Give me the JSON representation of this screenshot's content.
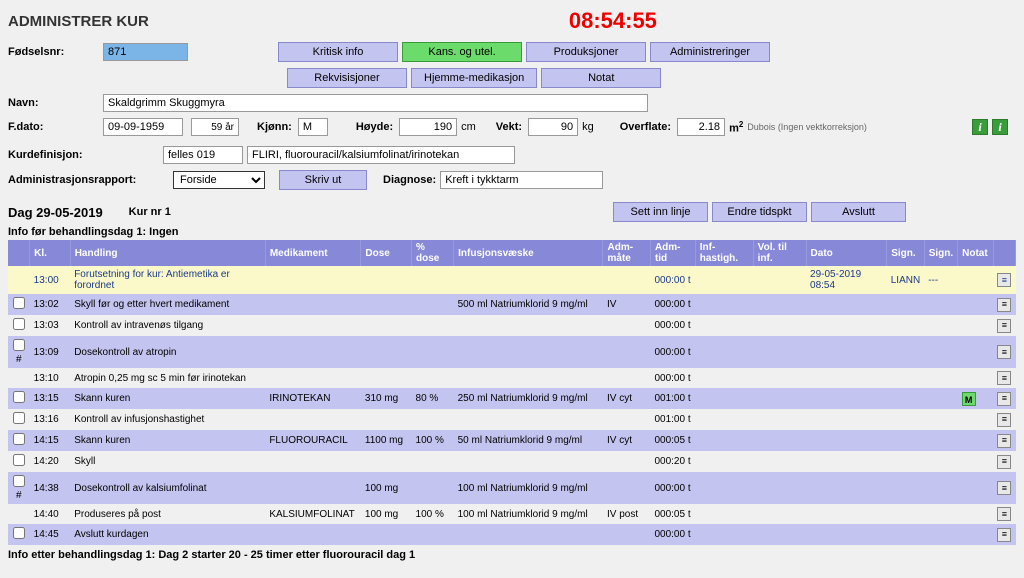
{
  "app_title": "ADMINISTRER KUR",
  "clock": "08:54:55",
  "labels": {
    "fodselsnr": "Fødselsnr:",
    "navn": "Navn:",
    "fdato": "F.dato:",
    "kjonn": "Kjønn:",
    "hoyde": "Høyde:",
    "vekt": "Vekt:",
    "overflate": "Overflate:",
    "kurdef": "Kurdefinisjon:",
    "adminrapport": "Administrasjonsrapport:",
    "diagnose": "Diagnose:",
    "cm": "cm",
    "kg": "kg",
    "m2": "m",
    "dubois": "Dubois (Ingen vektkorreksjon)",
    "info_for": "Info før behandlingsdag 1: Ingen",
    "info_etter": "Info etter behandlingsdag 1: Dag 2 starter 20 - 25 timer etter fluorouracil dag 1"
  },
  "buttons": {
    "kritisk": "Kritisk info",
    "kans": "Kans. og utel.",
    "produksjoner": "Produksjoner",
    "administreringer": "Administreringer",
    "rekvisisjoner": "Rekvisisjoner",
    "hjemme": "Hjemme-medikasjon",
    "notat": "Notat",
    "skrivut": "Skriv ut",
    "settinn": "Sett inn linje",
    "endre": "Endre tidspkt",
    "avslutt": "Avslutt"
  },
  "patient": {
    "fodselsnr": "871",
    "navn": "Skaldgrimm Skuggmyra",
    "fdato": "09-09-1959",
    "age": "59 år",
    "kjonn": "M",
    "hoyde": "190",
    "vekt": "90",
    "overflate": "2.18"
  },
  "kur": {
    "def1": "felles 019",
    "def2": "FLIRI, fluorouracil/kalsiumfolinat/irinotekan",
    "rapport": "Forside",
    "diagnose": "Kreft i tykktarm",
    "dag_title": "Dag 29-05-2019",
    "kurnr": "Kur nr 1"
  },
  "table": {
    "headers": [
      "Kl.",
      "Handling",
      "Medikament",
      "Dose",
      "% dose",
      "Infusjonsvæske",
      "Adm-måte",
      "Adm-tid",
      "Inf-hastigh.",
      "Vol. til inf.",
      "Dato",
      "Sign.",
      "Sign.",
      "Notat"
    ],
    "rows": [
      {
        "cb": false,
        "yellow": true,
        "kl": "13:00",
        "handling": "Forutsetning for kur: Antiemetika er forordnet",
        "med": "",
        "dose": "",
        "pct": "",
        "infv": "",
        "adm": "",
        "admtid": "000:00 t",
        "infh": "",
        "vol": "",
        "dato": "29-05-2019 08:54",
        "sign1": "LIANN",
        "sign2": "---",
        "notat": "",
        "mbadge": false
      },
      {
        "cb": true,
        "lav": true,
        "kl": "13:02",
        "handling": "Skyll før og etter hvert medikament",
        "med": "",
        "dose": "",
        "pct": "",
        "infv": "500 ml Natriumklorid 9 mg/ml",
        "adm": "IV",
        "admtid": "000:00 t",
        "infh": "",
        "vol": "",
        "dato": "",
        "sign1": "",
        "sign2": "",
        "notat": "",
        "mbadge": false
      },
      {
        "cb": true,
        "lav": false,
        "kl": "13:03",
        "handling": "Kontroll av intravenøs tilgang",
        "med": "",
        "dose": "",
        "pct": "",
        "infv": "",
        "adm": "",
        "admtid": "000:00 t",
        "infh": "",
        "vol": "",
        "dato": "",
        "sign1": "",
        "sign2": "",
        "notat": "",
        "mbadge": false
      },
      {
        "cb": true,
        "lav": true,
        "hash": "#",
        "kl": "13:09",
        "handling": "Dosekontroll av atropin",
        "med": "",
        "dose": "",
        "pct": "",
        "infv": "",
        "adm": "",
        "admtid": "000:00 t",
        "infh": "",
        "vol": "",
        "dato": "",
        "sign1": "",
        "sign2": "",
        "notat": "",
        "mbadge": false
      },
      {
        "cb": false,
        "lav": false,
        "kl": "13:10",
        "handling": "Atropin 0,25 mg sc 5 min før irinotekan",
        "med": "",
        "dose": "",
        "pct": "",
        "infv": "",
        "adm": "",
        "admtid": "000:00 t",
        "infh": "",
        "vol": "",
        "dato": "",
        "sign1": "",
        "sign2": "",
        "notat": "",
        "mbadge": false
      },
      {
        "cb": true,
        "lav": true,
        "kl": "13:15",
        "handling": "Skann kuren",
        "med": "IRINOTEKAN",
        "dose": "310 mg",
        "pct": "80 %",
        "infv": "250 ml Natriumklorid 9 mg/ml",
        "adm": "IV cyt",
        "admtid": "001:00 t",
        "infh": "",
        "vol": "",
        "dato": "",
        "sign1": "",
        "sign2": "",
        "notat": "",
        "mbadge": true
      },
      {
        "cb": true,
        "lav": false,
        "kl": "13:16",
        "handling": "Kontroll av infusjonshastighet",
        "med": "",
        "dose": "",
        "pct": "",
        "infv": "",
        "adm": "",
        "admtid": "001:00 t",
        "infh": "",
        "vol": "",
        "dato": "",
        "sign1": "",
        "sign2": "",
        "notat": "",
        "mbadge": false
      },
      {
        "cb": true,
        "lav": true,
        "kl": "14:15",
        "handling": "Skann kuren",
        "med": "FLUOROURACIL",
        "dose": "1100 mg",
        "pct": "100 %",
        "infv": "50 ml Natriumklorid 9 mg/ml",
        "adm": "IV cyt",
        "admtid": "000:05 t",
        "infh": "",
        "vol": "",
        "dato": "",
        "sign1": "",
        "sign2": "",
        "notat": "",
        "mbadge": false
      },
      {
        "cb": true,
        "lav": false,
        "kl": "14:20",
        "handling": "Skyll",
        "med": "",
        "dose": "",
        "pct": "",
        "infv": "",
        "adm": "",
        "admtid": "000:20 t",
        "infh": "",
        "vol": "",
        "dato": "",
        "sign1": "",
        "sign2": "",
        "notat": "",
        "mbadge": false
      },
      {
        "cb": true,
        "lav": true,
        "hash": "#",
        "kl": "14:38",
        "handling": "Dosekontroll av kalsiumfolinat",
        "med": "",
        "dose": "100 mg",
        "pct": "",
        "infv": "100 ml Natriumklorid 9 mg/ml",
        "adm": "",
        "admtid": "000:00 t",
        "infh": "",
        "vol": "",
        "dato": "",
        "sign1": "",
        "sign2": "",
        "notat": "",
        "mbadge": false
      },
      {
        "cb": false,
        "lav": false,
        "kl": "14:40",
        "handling": "Produseres på post",
        "med": "KALSIUMFOLINAT",
        "dose": "100 mg",
        "pct": "100 %",
        "infv": "100 ml Natriumklorid 9 mg/ml",
        "adm": "IV post",
        "admtid": "000:05 t",
        "infh": "",
        "vol": "",
        "dato": "",
        "sign1": "",
        "sign2": "",
        "notat": "",
        "mbadge": false
      },
      {
        "cb": true,
        "lav": true,
        "kl": "14:45",
        "handling": "Avslutt kurdagen",
        "med": "",
        "dose": "",
        "pct": "",
        "infv": "",
        "adm": "",
        "admtid": "000:00 t",
        "infh": "",
        "vol": "",
        "dato": "",
        "sign1": "",
        "sign2": "",
        "notat": "",
        "mbadge": false
      }
    ]
  }
}
